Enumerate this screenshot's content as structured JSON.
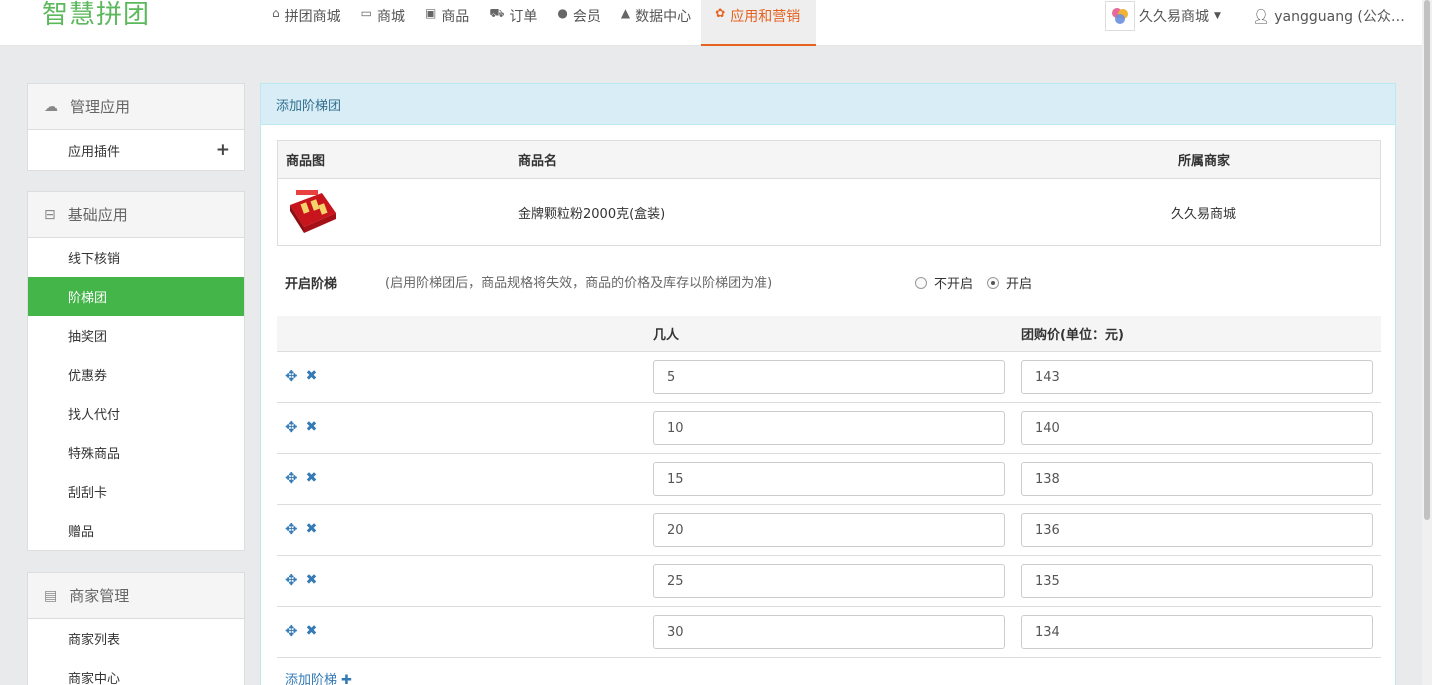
{
  "brand": {
    "logo": "智慧拼团",
    "logo_color": "#5cb85c"
  },
  "nav": {
    "items": [
      {
        "label": "拼团商城",
        "icon": "home-icon"
      },
      {
        "label": "商城",
        "icon": "monitor-icon"
      },
      {
        "label": "商品",
        "icon": "gift-icon"
      },
      {
        "label": "订单",
        "icon": "cart-icon"
      },
      {
        "label": "会员",
        "icon": "user-icon"
      },
      {
        "label": "数据中心",
        "icon": "chart-icon"
      },
      {
        "label": "应用和营销",
        "icon": "apps-icon",
        "active": true
      }
    ],
    "shop_name": "久久易商城",
    "user_name": "yangguang (公众号..."
  },
  "sidebar": {
    "groups": [
      {
        "title": "管理应用",
        "icon": "cloud-icon",
        "items": [
          "应用插件"
        ]
      },
      {
        "title": "基础应用",
        "icon": "inbox-icon",
        "items": [
          "线下核销",
          "阶梯团",
          "抽奖团",
          "优惠券",
          "找人代付",
          "特殊商品",
          "刮刮卡",
          "赠品"
        ]
      },
      {
        "title": "商家管理",
        "icon": "archive-icon",
        "items": [
          "商家列表",
          "商家中心"
        ]
      }
    ],
    "active_item": "阶梯团"
  },
  "main": {
    "title": "添加阶梯团",
    "goods_table": {
      "headers": {
        "image": "商品图",
        "name": "商品名",
        "merchant": "所属商家"
      },
      "row": {
        "name": "金牌颗粒粉2000克(盒装)",
        "merchant": "久久易商城"
      }
    },
    "ladder_toggle": {
      "label": "开启阶梯",
      "note": "(启用阶梯团后，商品规格将失效，商品的价格及库存以阶梯团为准)",
      "off_label": "不开启",
      "on_label": "开启",
      "selected": "on"
    },
    "ladder_table": {
      "headers": {
        "people": "几人",
        "price": "团购价(单位：元)"
      },
      "rows": [
        {
          "people": "5",
          "price": "143"
        },
        {
          "people": "10",
          "price": "140"
        },
        {
          "people": "15",
          "price": "138"
        },
        {
          "people": "20",
          "price": "136"
        },
        {
          "people": "25",
          "price": "135"
        },
        {
          "people": "30",
          "price": "134"
        }
      ]
    },
    "add_ladder_label": "添加阶梯"
  }
}
